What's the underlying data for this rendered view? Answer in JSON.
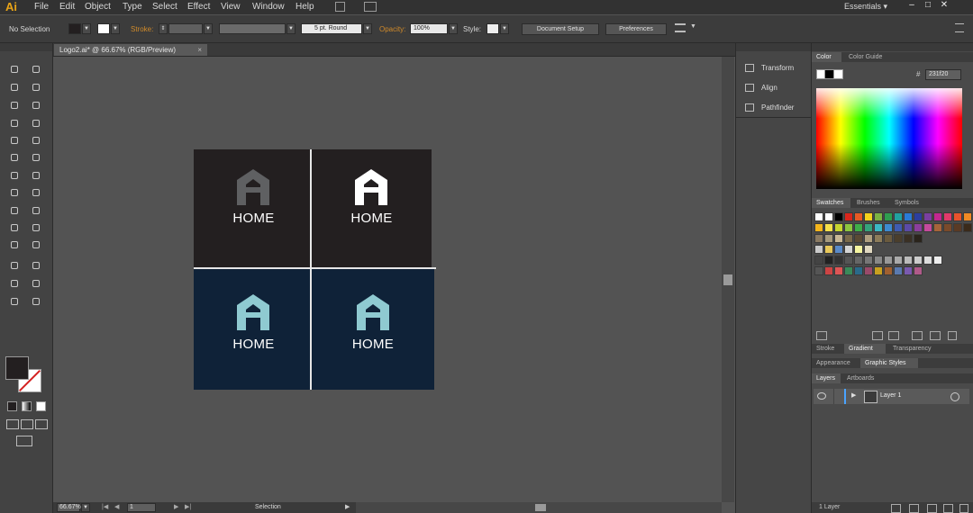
{
  "app": {
    "logo": "Ai"
  },
  "menu": [
    "File",
    "Edit",
    "Object",
    "Type",
    "Select",
    "Effect",
    "View",
    "Window",
    "Help"
  ],
  "workspace": {
    "label": "Essentials",
    "arrow": "▾"
  },
  "window_buttons": {
    "minimize": "–",
    "maximize": "□",
    "close": "✕"
  },
  "control_bar": {
    "selection_state": "No Selection",
    "stroke_label": "Stroke:",
    "brush_value": "5 pt. Round",
    "opacity_label": "Opacity:",
    "opacity_value": "100%",
    "style_label": "Style:",
    "document_setup": "Document Setup",
    "preferences": "Preferences"
  },
  "document": {
    "tab_title": "Logo2.ai* @ 66.67% (RGB/Preview)",
    "close": "×"
  },
  "artboard": {
    "quadrants": [
      {
        "label": "HOME",
        "bg": "#231f20",
        "logo_color": "#5f6062"
      },
      {
        "label": "HOME",
        "bg": "#231f20",
        "logo_color": "#ffffff"
      },
      {
        "label": "HOME",
        "bg": "#0f2238",
        "logo_color": "#8fcad1"
      },
      {
        "label": "HOME",
        "bg": "#0f2238",
        "logo_color": "#8fcad1"
      }
    ]
  },
  "status_bar": {
    "zoom": "66.67%",
    "page": "1",
    "tool": "Selection"
  },
  "dock": [
    {
      "label": "Transform",
      "icon": "transform-icon"
    },
    {
      "label": "Align",
      "icon": "align-icon"
    },
    {
      "label": "Pathfinder",
      "icon": "pathfinder-icon"
    }
  ],
  "color_panel": {
    "tabs": [
      "Color",
      "Color Guide"
    ],
    "hex": "231f20"
  },
  "swatches_panel": {
    "tabs": [
      "Swatches",
      "Brushes",
      "Symbols"
    ]
  },
  "stroke_panel": {
    "tabs": [
      "Stroke",
      "Gradient",
      "Transparency"
    ]
  },
  "appearance_panel": {
    "tabs": [
      "Appearance",
      "Graphic Styles"
    ]
  },
  "layers_panel": {
    "tabs": [
      "Layers",
      "Artboards"
    ],
    "layer_name": "Layer 1",
    "footer": "1 Layer"
  },
  "colors": {
    "fill": "#231f20",
    "stroke": "#ffffff",
    "accent": "#e8a317"
  }
}
